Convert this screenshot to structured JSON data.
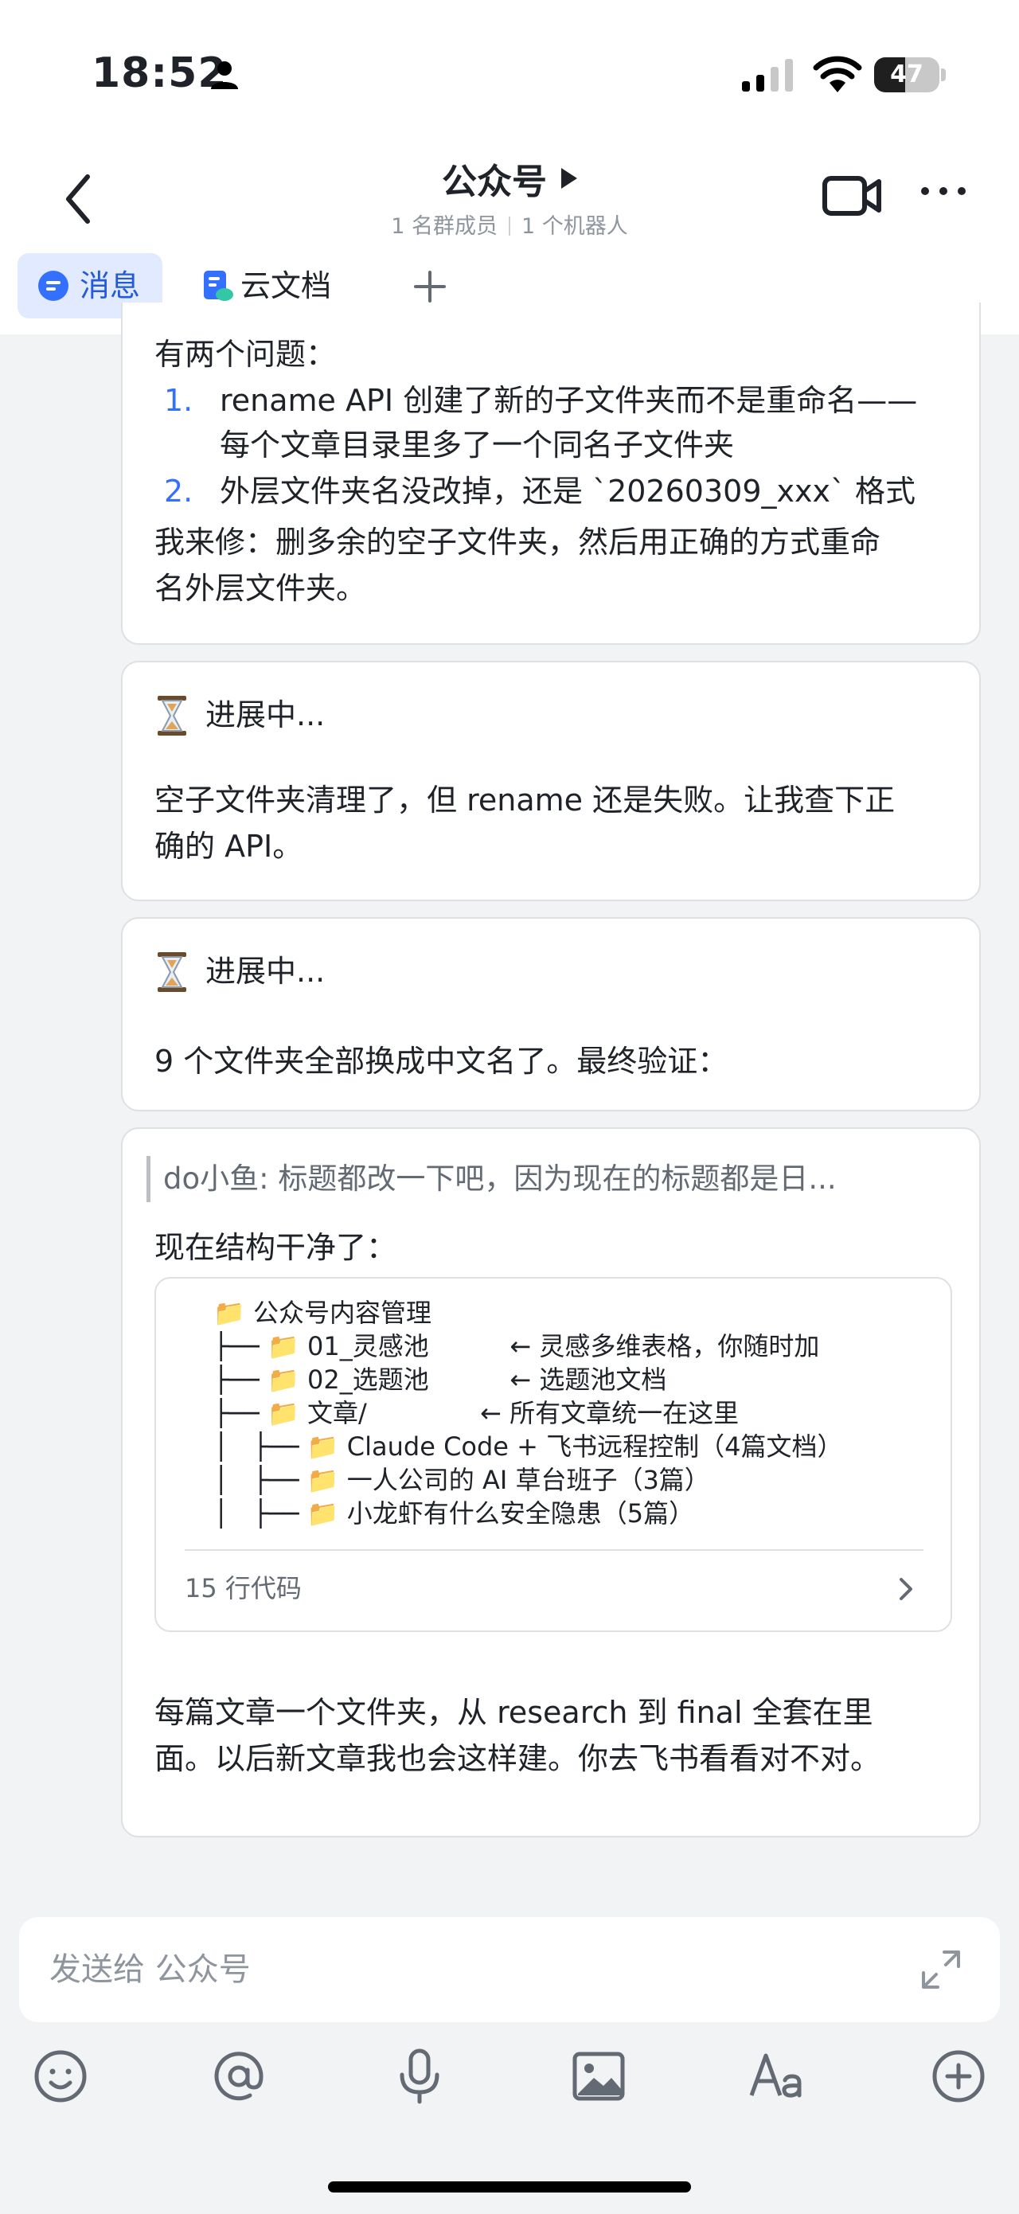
{
  "status_bar": {
    "time": "18:52",
    "battery": "47",
    "battery_level": 0.47
  },
  "header": {
    "title": "公众号",
    "members": "1 名群成员",
    "bots": "1 个机器人"
  },
  "tabs": [
    {
      "label": "消息",
      "active": true
    },
    {
      "label": "云文档",
      "active": false
    }
  ],
  "messages": {
    "m1": {
      "intro": "有两个问题：",
      "items": [
        {
          "num": "1.",
          "line1": "rename API 创建了新的子文件夹而不是重命名——",
          "line2": "每个文章目录里多了一个同名子文件夹"
        },
        {
          "num": "2.",
          "line1": "外层文件夹名没改掉，还是 `20260309_xxx` 格式"
        }
      ],
      "fix_line1": "我来修：删多余的空子文件夹，然后用正确的方式重命",
      "fix_line2": "名外层文件夹。"
    },
    "m2": {
      "status": "进展中...",
      "line1": "空子文件夹清理了，但 rename 还是失败。让我查下正",
      "line2": "确的 API。"
    },
    "m3": {
      "status": "进展中...",
      "line1": "9 个文件夹全部换成中文名了。最终验证："
    },
    "m4": {
      "quote": "do小鱼: 标题都改一下吧，因为现在的标题都是日...",
      "intro": "现在结构干净了：",
      "code_lines": [
        "📁 公众号内容管理",
        "├── 📁 01_灵感池          ← 灵感多维表格，你随时加",
        "├── 📁 02_选题池          ← 选题池文档",
        "├── 📁 文章/              ← 所有文章统一在这里",
        "│   ├── 📁 Claude Code + 飞书远程控制（4篇文档）",
        "│   ├── 📁 一人公司的 AI 草台班子（3篇）",
        "│   ├── 📁 小龙虾有什么安全隐患（5篇）"
      ],
      "code_footer": "15 行代码",
      "outro_line1": "每篇文章一个文件夹，从 research 到 final 全套在里",
      "outro_line2": "面。以后新文章我也会这样建。你去飞书看看对不对。"
    }
  },
  "composer": {
    "placeholder": "发送给 公众号"
  },
  "toolbar": [
    "emoji-icon",
    "mention-icon",
    "microphone-icon",
    "image-icon",
    "font-icon",
    "plus-circle-icon"
  ],
  "colors": {
    "accent": "#3370ff",
    "active_tab_bg": "#e1eaff",
    "active_tab_text": "#245bdb"
  }
}
